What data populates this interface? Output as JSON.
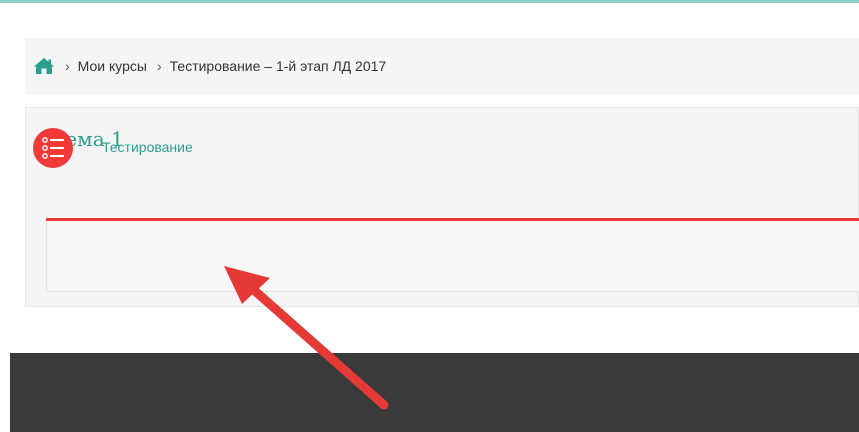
{
  "breadcrumb": {
    "home_icon": "home-icon",
    "items": [
      {
        "label": "Мои курсы"
      },
      {
        "label": "Тестирование – 1-й этап ЛД 2017"
      }
    ],
    "separator": "›"
  },
  "section": {
    "title": "Тема 1",
    "accent_color": "#e83a3a",
    "activity": {
      "icon": "quiz-list-icon",
      "label": "Тестирование"
    }
  },
  "colors": {
    "brand": "#2b9e8d",
    "top_border": "#8fcfc4",
    "footer": "#3a3a3a",
    "arrow": "#e53935"
  }
}
